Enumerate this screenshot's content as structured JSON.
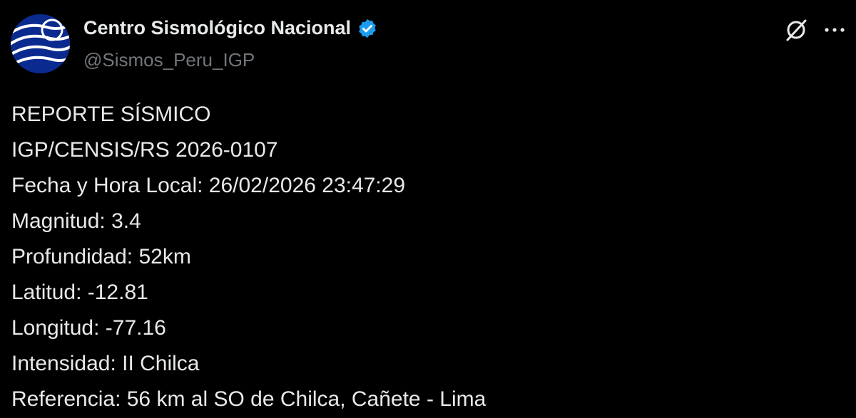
{
  "author": {
    "display_name": "Centro Sismológico Nacional",
    "handle": "@Sismos_Peru_IGP",
    "avatar_icon": "igp-logo-icon",
    "verified_icon": "verified-badge-icon"
  },
  "actions": {
    "grok_icon": "grok-icon",
    "more_icon": "more-options-icon"
  },
  "tweet": {
    "lines": [
      "REPORTE SÍSMICO",
      "IGP/CENSIS/RS 2026-0107",
      "Fecha y Hora Local: 26/02/2026 23:47:29",
      "Magnitud: 3.4",
      "Profundidad: 52km",
      "Latitud: -12.81",
      "Longitud: -77.16",
      "Intensidad: II Chilca",
      "Referencia: 56 km al SO de Chilca, Cañete - Lima"
    ]
  },
  "colors": {
    "background": "#000000",
    "text": "#e7e9ea",
    "secondary_text": "#71767b",
    "verified_blue": "#1d9bf0",
    "avatar_blue": "#0a2a8f"
  }
}
